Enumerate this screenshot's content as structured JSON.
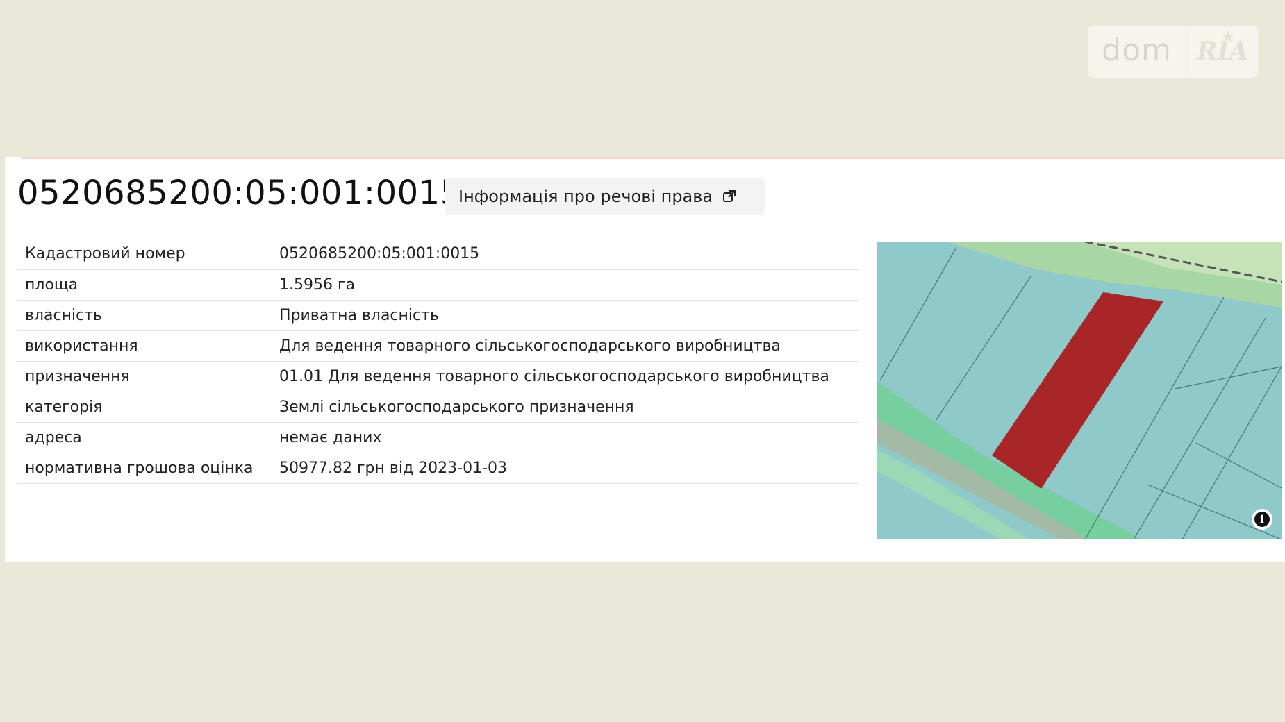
{
  "logo": {
    "dom": "dom",
    "ria": "RIA"
  },
  "parcel": {
    "title": "0520685200:05:001:0015",
    "rights_link_label": "Інформація про речові права",
    "rows": [
      {
        "label": "Кадастровий номер",
        "value": "0520685200:05:001:0015"
      },
      {
        "label": "площа",
        "value": "1.5956 га"
      },
      {
        "label": "власність",
        "value": "Приватна власність"
      },
      {
        "label": "використання",
        "value": "Для ведення товарного сільськогосподарського виробництва"
      },
      {
        "label": "призначення",
        "value": "01.01 Для ведення товарного сільськогосподарського виробництва"
      },
      {
        "label": "категорія",
        "value": "Землі сільськогосподарського призначення"
      },
      {
        "label": "адреса",
        "value": "немає даних"
      },
      {
        "label": "нормативна грошова оцінка",
        "value": "50977.82 грн від 2023-01-03"
      }
    ]
  },
  "map": {
    "parcel_color": "#a82628",
    "plot_color": "#8fc9ca",
    "road_color": "#77cf9f",
    "info_icon": "i"
  }
}
